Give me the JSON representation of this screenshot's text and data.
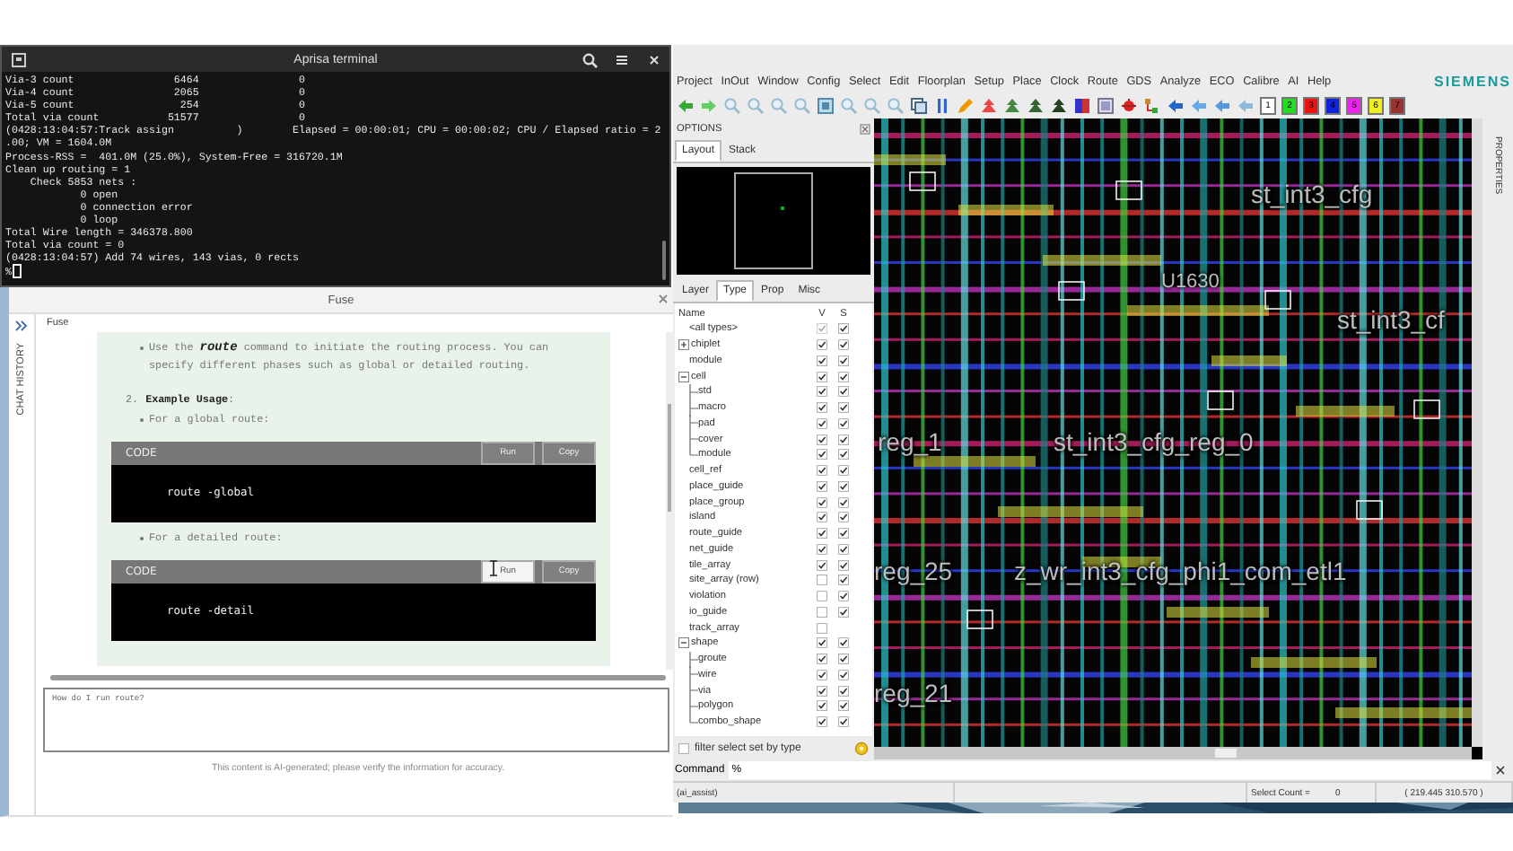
{
  "terminal": {
    "title": "Aprisa terminal",
    "lines": [
      "Via-3 count                6464                0",
      "Via-4 count                2065                0",
      "Via-5 count                 254                0",
      "Total via count           51577                0",
      "(0428:13:04:57:Track assign          )        Elapsed = 00:00:01; CPU = 00:00:02; CPU / Elapsed ratio = 2",
      ".00; VM = 1604.0M",
      "Process-RSS =  401.0M (25.0%), System-Free = 316720.1M",
      "Clean up routing = 1",
      "    Check 5853 nets :",
      "            0 open",
      "            0 connection error",
      "            0 loop",
      "Total Wire length = 346378.800",
      "Total via count = 0",
      "(0428:13:04:57) Add 74 wires, 143 vias, 0 rects"
    ],
    "prompt": "%"
  },
  "chat": {
    "title": "Fuse",
    "sidebar_label": "CHAT HISTORY",
    "tab": "Fuse",
    "blocks": [
      {
        "kind": "bullet",
        "text": "Use the **route** command to initiate the routing process. You can specify different phases such as global or detailed routing."
      },
      {
        "kind": "heading",
        "number": "2.",
        "text": "**Example Usage**:"
      },
      {
        "kind": "bullet",
        "text": "For a global route:"
      },
      {
        "kind": "code",
        "label": "CODE",
        "code": "route -global",
        "buttons": [
          {
            "label": "Run",
            "hover": false
          },
          {
            "label": "Copy",
            "hover": false
          }
        ]
      },
      {
        "kind": "bullet",
        "text": "For a detailed route:"
      },
      {
        "kind": "code",
        "label": "CODE",
        "code": "route -detail",
        "buttons": [
          {
            "label": "Run",
            "hover": true
          },
          {
            "label": "Copy",
            "hover": false
          }
        ]
      }
    ],
    "input": {
      "value": "How do I run route?"
    },
    "footer": "This content is AI-generated; please verify the information for accuracy."
  },
  "app": {
    "menu": [
      "Project",
      "InOut",
      "Window",
      "Config",
      "Select",
      "Edit",
      "Floorplan",
      "Setup",
      "Place",
      "Clock",
      "Route",
      "GDS",
      "Analyze",
      "ECO",
      "Calibre",
      "AI",
      "Help"
    ],
    "logo": "SIEMENS",
    "layer_buttons": [
      {
        "label": "1",
        "color": "#ffffff"
      },
      {
        "label": "2",
        "color": "#22dd22"
      },
      {
        "label": "3",
        "color": "#ee1111"
      },
      {
        "label": "4",
        "color": "#1122dd"
      },
      {
        "label": "5",
        "color": "#ee22ee"
      },
      {
        "label": "6",
        "color": "#eeee22"
      },
      {
        "label": "7",
        "color": "#993333"
      }
    ],
    "options": {
      "title": "OPTIONS",
      "view_tabs": [
        {
          "label": "Layout",
          "selected": true
        },
        {
          "label": "Stack",
          "selected": false
        }
      ],
      "tabs": [
        {
          "label": "Layer",
          "selected": false
        },
        {
          "label": "Type",
          "selected": true
        },
        {
          "label": "Prop",
          "selected": false
        },
        {
          "label": "Misc",
          "selected": false
        }
      ],
      "columns": [
        "Name",
        "V",
        "S"
      ],
      "types": [
        {
          "name": "<all types>",
          "v": true,
          "s": true
        },
        {
          "name": "chiplet",
          "expanded": false,
          "v": true,
          "s": true
        },
        {
          "name": "module",
          "v": true,
          "s": true
        },
        {
          "name": "cell",
          "expanded": true,
          "v": true,
          "s": true,
          "children": [
            {
              "name": "std",
              "v": true,
              "s": true
            },
            {
              "name": "macro",
              "v": true,
              "s": true
            },
            {
              "name": "pad",
              "v": true,
              "s": true
            },
            {
              "name": "cover",
              "v": true,
              "s": true
            },
            {
              "name": "module",
              "v": true,
              "s": true
            }
          ]
        },
        {
          "name": "cell_ref",
          "v": true,
          "s": true
        },
        {
          "name": "place_guide",
          "v": true,
          "s": true
        },
        {
          "name": "place_group",
          "v": true,
          "s": true
        },
        {
          "name": "island",
          "v": true,
          "s": true
        },
        {
          "name": "route_guide",
          "v": true,
          "s": true
        },
        {
          "name": "net_guide",
          "v": true,
          "s": true
        },
        {
          "name": "tile_array",
          "v": true,
          "s": true
        },
        {
          "name": "site_array (row)",
          "v": false,
          "s": true
        },
        {
          "name": "violation",
          "v": false,
          "s": true
        },
        {
          "name": "io_guide",
          "v": false,
          "s": true
        },
        {
          "name": "track_array",
          "v": false
        },
        {
          "name": "shape",
          "expanded": true,
          "v": true,
          "s": true,
          "children": [
            {
              "name": "groute",
              "v": true,
              "s": true
            },
            {
              "name": "wire",
              "v": true,
              "s": true
            },
            {
              "name": "via",
              "v": true,
              "s": true
            },
            {
              "name": "polygon",
              "v": true,
              "s": true
            },
            {
              "name": "combo_shape",
              "v": true,
              "s": true
            }
          ]
        }
      ],
      "filter": {
        "label": "filter select set by type",
        "checked": false
      }
    },
    "canvas_labels": [
      "st_int3_cfg",
      "U1630",
      "st_int3_cf",
      "reg_1",
      "st_int3_cfg_reg_0",
      "reg_25",
      "z_wr_int3_cfg_phi1_com_etl1",
      "reg_21"
    ],
    "side_label": "PROPERTIES",
    "command": {
      "label": "Command",
      "value": "%"
    },
    "status": {
      "context": "(ai_assist)",
      "select_label": "Select Count =",
      "select_count": "0",
      "coords": "( 219.445 310.570 )"
    }
  }
}
